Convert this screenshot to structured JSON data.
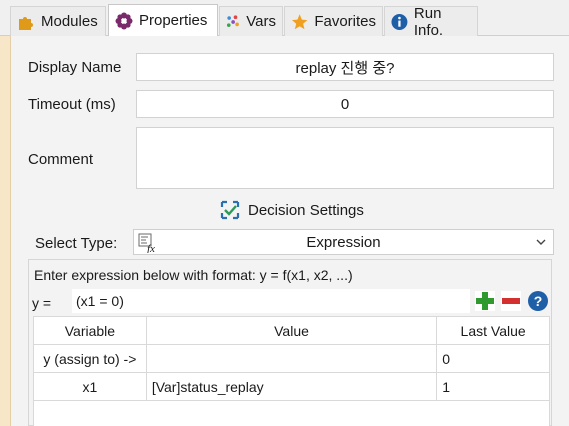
{
  "tabs": [
    {
      "label": "Modules",
      "icon": "puzzle-icon"
    },
    {
      "label": "Properties",
      "icon": "flower-gear-icon",
      "active": true
    },
    {
      "label": "Vars",
      "icon": "dots-icon"
    },
    {
      "label": "Favorites",
      "icon": "star-icon"
    },
    {
      "label": "Run Info.",
      "icon": "info-icon"
    }
  ],
  "form": {
    "display_name_label": "Display Name",
    "display_name_value": "replay 진행 중?",
    "timeout_label": "Timeout (ms)",
    "timeout_value": "0",
    "comment_label": "Comment",
    "comment_value": ""
  },
  "decision": {
    "title": "Decision Settings",
    "select_type_label": "Select Type:",
    "select_type_value": "Expression"
  },
  "expression": {
    "hint": "Enter expression below with format: y = f(x1, x2, ...)",
    "y_label": "y =",
    "value": "(x1 = 0)"
  },
  "table": {
    "headers": [
      "Variable",
      "Value",
      "Last Value"
    ],
    "rows": [
      [
        "y (assign to) ->",
        "",
        "0"
      ],
      [
        "x1",
        "[Var]status_replay",
        "1"
      ]
    ]
  },
  "colors": {
    "accent_orange": "#f0a020",
    "info_blue": "#1f5fa8",
    "add_green": "#2e9a2e",
    "remove_red": "#d43030",
    "help_blue": "#1f5fa8"
  }
}
